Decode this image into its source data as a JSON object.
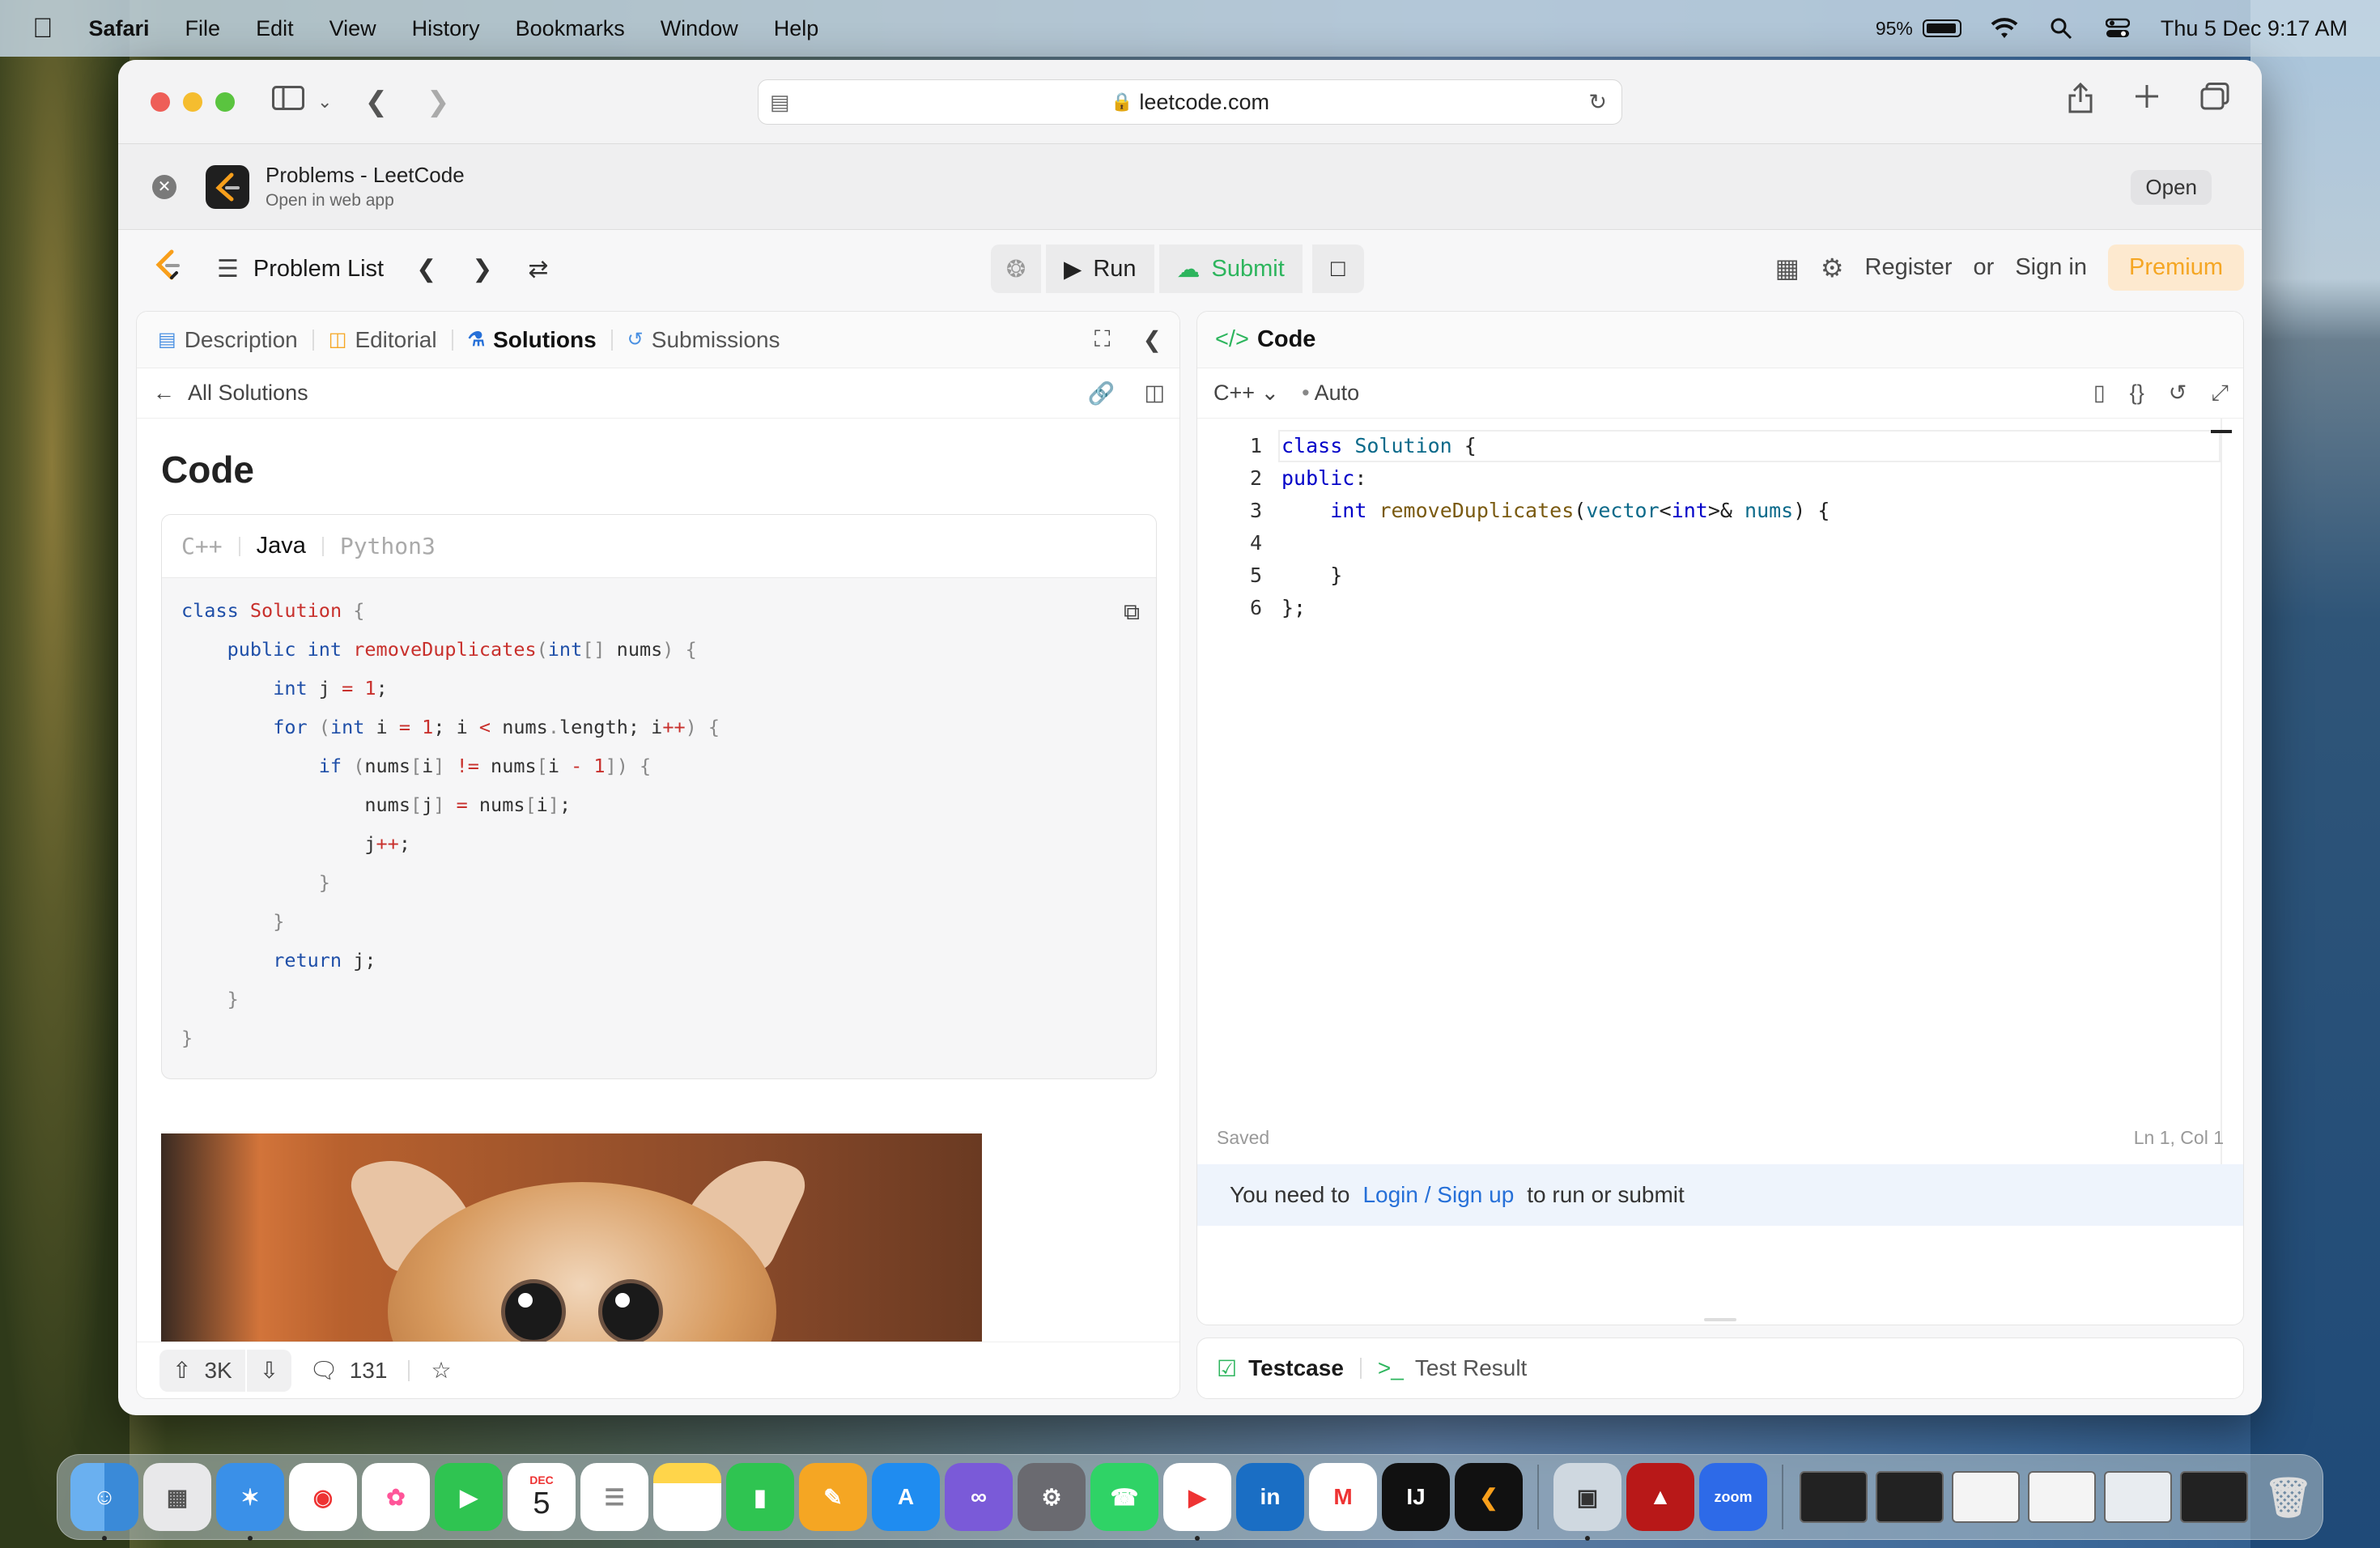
{
  "menubar": {
    "app": "Safari",
    "items": [
      "File",
      "Edit",
      "View",
      "History",
      "Bookmarks",
      "Window",
      "Help"
    ],
    "battery": "95%",
    "datetime": "Thu 5 Dec  9:17 AM"
  },
  "browser": {
    "url": "leetcode.com"
  },
  "banner": {
    "title": "Problems - LeetCode",
    "subtitle": "Open in web app",
    "open_label": "Open"
  },
  "lcnav": {
    "problem_list": "Problem List",
    "run_label": "Run",
    "submit_label": "Submit",
    "register": "Register",
    "or": "or",
    "signin": "Sign in",
    "premium": "Premium"
  },
  "left_panel": {
    "tabs": [
      "Description",
      "Editorial",
      "Solutions",
      "Submissions"
    ],
    "back_label": "All Solutions",
    "heading": "Code",
    "lang_tabs": [
      "C++",
      "Java",
      "Python3"
    ],
    "active_lang": "Java",
    "upvotes": "3K",
    "comments": "131"
  },
  "right_panel": {
    "title": "Code",
    "language": "C++",
    "mode": "Auto",
    "saved": "Saved",
    "cursor": "Ln 1, Col 1",
    "login_prefix": "You need to",
    "login_link": "Login / Sign up",
    "login_suffix": "to run or submit",
    "bottom_tabs": [
      "Testcase",
      "Test Result"
    ]
  },
  "dock": {
    "calendar_month": "DEC",
    "calendar_day": "5",
    "zoom_label": "zoom",
    "ij_label": "IJ"
  },
  "colors": {
    "accent": "#f89f1b",
    "submit_green": "#2db55d",
    "link_blue": "#2670d8"
  }
}
